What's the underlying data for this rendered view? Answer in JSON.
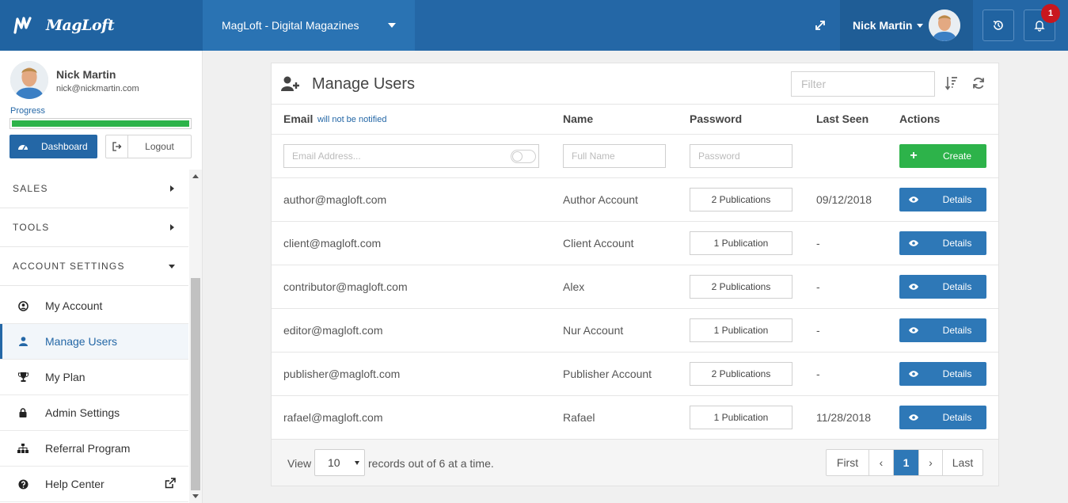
{
  "app": {
    "brand_name": "MagLoft",
    "project_name": "MagLoft - Digital Magazines",
    "user_name": "Nick Martin",
    "notification_count": "1"
  },
  "sidebar": {
    "profile": {
      "name": "Nick Martin",
      "email": "nick@nickmartin.com",
      "progress_label": "Progress",
      "progress_percent": 100
    },
    "dashboard_label": "Dashboard",
    "logout_label": "Logout",
    "sections": [
      {
        "label": "SALES"
      },
      {
        "label": "TOOLS"
      },
      {
        "label": "ACCOUNT SETTINGS"
      }
    ],
    "items": [
      {
        "label": "My Account",
        "icon": "user-circle-icon"
      },
      {
        "label": "Manage Users",
        "icon": "user-icon"
      },
      {
        "label": "My Plan",
        "icon": "trophy-icon"
      },
      {
        "label": "Admin Settings",
        "icon": "lock-icon"
      },
      {
        "label": "Referral Program",
        "icon": "sitemap-icon"
      },
      {
        "label": "Help Center",
        "icon": "question-circle-icon"
      }
    ]
  },
  "panel": {
    "title": "Manage Users",
    "filter_placeholder": "Filter",
    "columns": {
      "email": "Email",
      "email_note": "will not be notified",
      "name": "Name",
      "password": "Password",
      "last_seen": "Last Seen",
      "actions": "Actions"
    },
    "new_user": {
      "email_placeholder": "Email Address...",
      "name_placeholder": "Full Name",
      "password_placeholder": "Password",
      "create_label": "Create"
    },
    "details_label": "Details",
    "rows": [
      {
        "email": "author@magloft.com",
        "name": "Author Account",
        "publications": "2 Publications",
        "last_seen": "09/12/2018"
      },
      {
        "email": "client@magloft.com",
        "name": "Client Account",
        "publications": "1 Publication",
        "last_seen": "-"
      },
      {
        "email": "contributor@magloft.com",
        "name": "Alex",
        "publications": "2 Publications",
        "last_seen": "-"
      },
      {
        "email": "editor@magloft.com",
        "name": "Nur Account",
        "publications": "1 Publication",
        "last_seen": "-"
      },
      {
        "email": "publisher@magloft.com",
        "name": "Publisher Account",
        "publications": "2 Publications",
        "last_seen": "-"
      },
      {
        "email": "rafael@magloft.com",
        "name": "Rafael",
        "publications": "1 Publication",
        "last_seen": "11/28/2018"
      }
    ],
    "footer": {
      "view_label": "View",
      "per_page": "10",
      "records_label": "records out of 6 at a time.",
      "pager": {
        "first": "First",
        "prev": "‹",
        "current": "1",
        "next": "›",
        "last": "Last"
      }
    }
  },
  "colors": {
    "primary": "#2467a6",
    "success": "#2db34a",
    "danger": "#c9171e"
  }
}
